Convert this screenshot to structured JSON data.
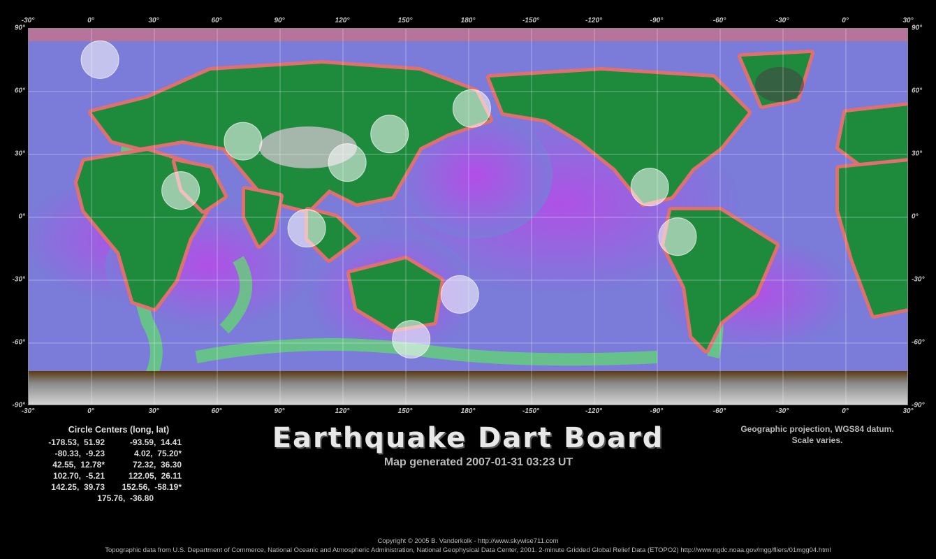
{
  "map": {
    "top_ticks": [
      "-30°",
      "0°",
      "30°",
      "60°",
      "90°",
      "120°",
      "150°",
      "180°",
      "-150°",
      "-120°",
      "-90°",
      "-60°",
      "-30°",
      "0°",
      "30°"
    ],
    "bottom_ticks": [
      "-30°",
      "0°",
      "30°",
      "60°",
      "90°",
      "120°",
      "150°",
      "180°",
      "-150°",
      "-120°",
      "-90°",
      "-60°",
      "-30°",
      "0°",
      "30°"
    ],
    "left_ticks": [
      "90°",
      "60°",
      "30°",
      "0°",
      "-30°",
      "-60°",
      "-90°"
    ],
    "right_ticks": [
      "90°",
      "60°",
      "30°",
      "0°",
      "-30°",
      "-60°",
      "-90°"
    ],
    "lon_range": [
      -30,
      390
    ],
    "lat_range": [
      -90,
      90
    ],
    "graticule_step": 30,
    "colors": {
      "ocean": "#7b7bd9",
      "deep": "#a24de0",
      "shelf": "#5fe06a",
      "coast": "#e07070",
      "land": "#1e8a3c",
      "highland": "#6f6a1a",
      "ice": "#bbbbbb"
    },
    "circles": [
      {
        "lon": -178.53,
        "lat": 51.92
      },
      {
        "lon": -93.59,
        "lat": 14.41
      },
      {
        "lon": -80.33,
        "lat": -9.23
      },
      {
        "lon": 4.02,
        "lat": 75.2
      },
      {
        "lon": 42.55,
        "lat": 12.78
      },
      {
        "lon": 72.32,
        "lat": 36.3
      },
      {
        "lon": 102.7,
        "lat": -5.21
      },
      {
        "lon": 122.05,
        "lat": 26.11
      },
      {
        "lon": 142.25,
        "lat": 39.73
      },
      {
        "lon": 152.56,
        "lat": -58.19
      },
      {
        "lon": 175.76,
        "lat": -36.8
      }
    ]
  },
  "centers": {
    "title": "Circle Centers (long, lat)",
    "rows": [
      [
        "-178.53,  51.92",
        "-93.59,  14.41"
      ],
      [
        "-80.33,  -9.23",
        "4.02,  75.20*"
      ],
      [
        "42.55,  12.78*",
        "72.32,  36.30"
      ],
      [
        "102.70,  -5.21",
        "122.05,  26.11"
      ],
      [
        "142.25,  39.73",
        "152.56,  -58.19*"
      ]
    ],
    "last": "175.76,  -36.80"
  },
  "title": "Earthquake Dart Board",
  "subtitle": "Map generated 2007-01-31 03:23 UT",
  "projection": {
    "line1": "Geographic projection, WGS84 datum.",
    "line2": "Scale varies."
  },
  "footer": {
    "copyright": "Copyright © 2005 B. Vanderkolk - http://www.skywise711.com",
    "source": "Topographic data from U.S. Department of Commerce, National Oceanic and Atmospheric Administration, National Geophysical Data Center, 2001. 2-minute Gridded Global Relief Data (ETOPO2) http://www.ngdc.noaa.gov/mgg/fliers/01mgg04.html"
  }
}
